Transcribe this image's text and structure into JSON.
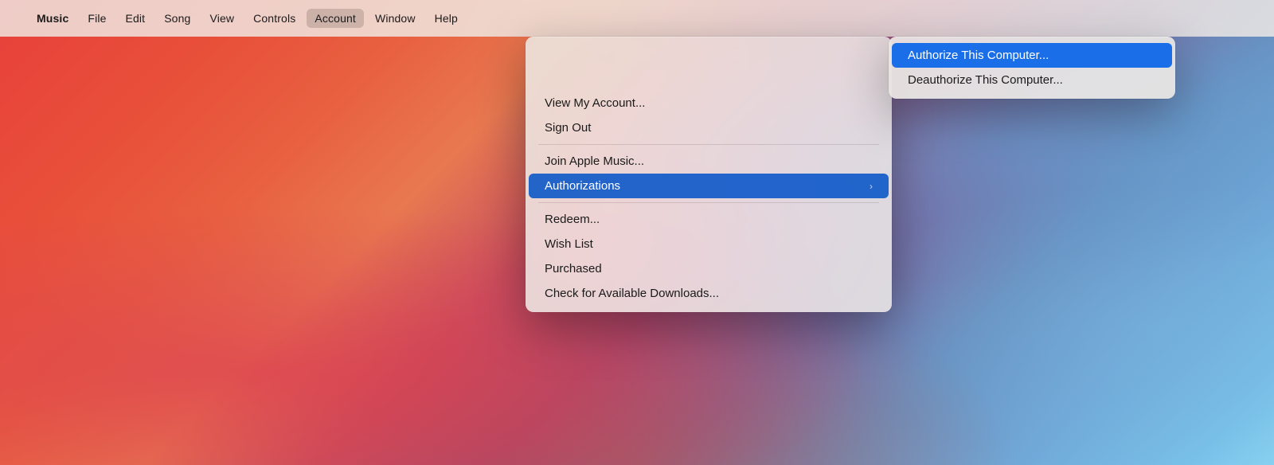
{
  "desktop": {
    "bg_description": "macOS Big Sur gradient wallpaper"
  },
  "menubar": {
    "apple_label": "",
    "items": [
      {
        "id": "music",
        "label": "Music",
        "bold": true,
        "active": false
      },
      {
        "id": "file",
        "label": "File",
        "bold": false,
        "active": false
      },
      {
        "id": "edit",
        "label": "Edit",
        "bold": false,
        "active": false
      },
      {
        "id": "song",
        "label": "Song",
        "bold": false,
        "active": false
      },
      {
        "id": "view",
        "label": "View",
        "bold": false,
        "active": false
      },
      {
        "id": "controls",
        "label": "Controls",
        "bold": false,
        "active": false
      },
      {
        "id": "account",
        "label": "Account",
        "bold": false,
        "active": true
      },
      {
        "id": "window",
        "label": "Window",
        "bold": false,
        "active": false
      },
      {
        "id": "help",
        "label": "Help",
        "bold": false,
        "active": false
      }
    ]
  },
  "account_menu": {
    "items": [
      {
        "id": "view-my-account",
        "label": "View My Account...",
        "separator_after": false,
        "has_submenu": false
      },
      {
        "id": "sign-out",
        "label": "Sign Out",
        "separator_after": true,
        "has_submenu": false
      },
      {
        "id": "join-apple-music",
        "label": "Join Apple Music...",
        "separator_after": false,
        "has_submenu": false
      },
      {
        "id": "authorizations",
        "label": "Authorizations",
        "separator_after": true,
        "has_submenu": true,
        "highlighted": true
      },
      {
        "id": "redeem",
        "label": "Redeem...",
        "separator_after": false,
        "has_submenu": false
      },
      {
        "id": "wish-list",
        "label": "Wish List",
        "separator_after": false,
        "has_submenu": false
      },
      {
        "id": "purchased",
        "label": "Purchased",
        "separator_after": false,
        "has_submenu": false
      },
      {
        "id": "check-downloads",
        "label": "Check for Available Downloads...",
        "separator_after": false,
        "has_submenu": false
      }
    ]
  },
  "authorizations_submenu": {
    "items": [
      {
        "id": "authorize-computer",
        "label": "Authorize This Computer...",
        "highlighted": true
      },
      {
        "id": "deauthorize-computer",
        "label": "Deauthorize This Computer...",
        "highlighted": false
      }
    ]
  },
  "icons": {
    "arrow_right": "›",
    "apple": ""
  }
}
